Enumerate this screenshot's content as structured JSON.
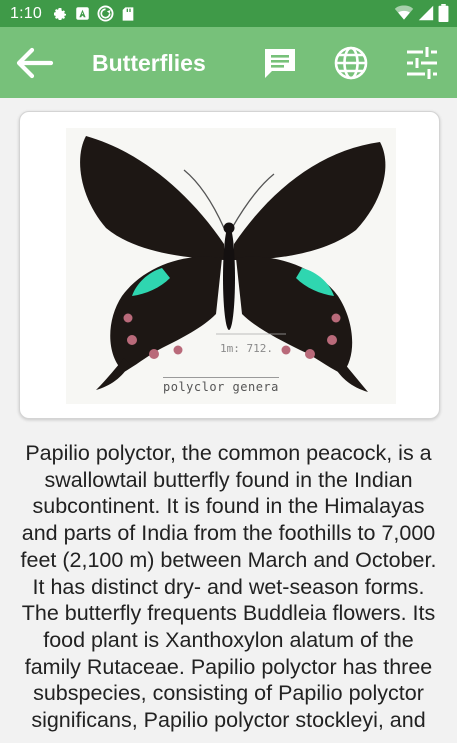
{
  "status_bar": {
    "time": "1:10",
    "left_icons": [
      "settings-icon",
      "a-badge-icon",
      "sync-icon",
      "sd-card-icon"
    ],
    "right_icons": [
      "wifi-icon",
      "signal-icon",
      "battery-icon"
    ]
  },
  "app_bar": {
    "title": "Butterflies",
    "back_icon": "arrow-left-icon",
    "actions": [
      "message-icon",
      "globe-icon",
      "tune-icon"
    ]
  },
  "specimen": {
    "label_text": "polyclor genera",
    "tag_text": "1m: 712.",
    "colors": {
      "wing": "#1d1714",
      "band": "#2fd6b0",
      "spot": "#b96a7a"
    }
  },
  "description": "Papilio polyctor, the common peacock, is a swallowtail butterfly found in the Indian subcontinent. It is found in the Himalayas and parts of India from the foothills to 7,000 feet (2,100 m) between March and October. It has distinct dry- and wet-season forms. The butterfly frequents Buddleia flowers. Its food plant is Xanthoxylon alatum of the family Rutaceae. Papilio polyctor has three subspecies, consisting of Papilio polyctor significans, Papilio polyctor stockleyi, and",
  "colors": {
    "status_bar": "#3f9a48",
    "app_bar": "#77c17a",
    "background": "#f2f2f2"
  }
}
